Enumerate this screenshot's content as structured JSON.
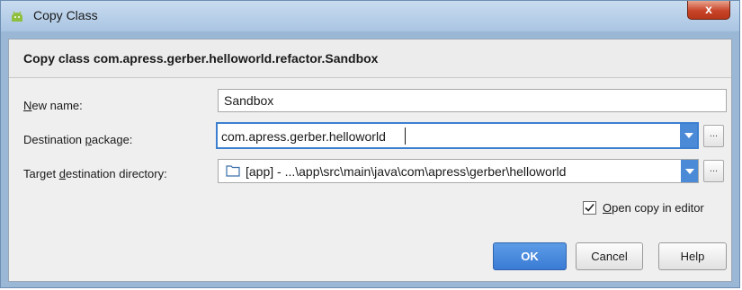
{
  "window": {
    "title": "Copy Class",
    "close_label": "x"
  },
  "header": {
    "text": "Copy class com.apress.gerber.helloworld.refactor.Sandbox"
  },
  "form": {
    "new_name": {
      "label_mnemonic": "N",
      "label_rest": "ew name:",
      "value": "Sandbox"
    },
    "destination_package": {
      "label_before": "Destination ",
      "label_mnemonic": "p",
      "label_after": "ackage:",
      "value": "com.apress.gerber.helloworld",
      "browse_label": "..."
    },
    "target_directory": {
      "label_before": "Target ",
      "label_mnemonic": "d",
      "label_after": "estination directory:",
      "value": "[app] - ...\\app\\src\\main\\java\\com\\apress\\gerber\\helloworld",
      "browse_label": "..."
    },
    "open_copy": {
      "label_mnemonic": "O",
      "label_rest": "pen copy in editor",
      "checked": true
    }
  },
  "buttons": {
    "ok": "OK",
    "cancel": "Cancel",
    "help": "Help"
  },
  "colors": {
    "accent": "#4a8ad6",
    "title_bar": "#b9d1ea",
    "close": "#c8442a"
  },
  "icons": {
    "title": "android-icon",
    "folder": "folder-icon",
    "dropdown": "chevron-down-icon"
  }
}
